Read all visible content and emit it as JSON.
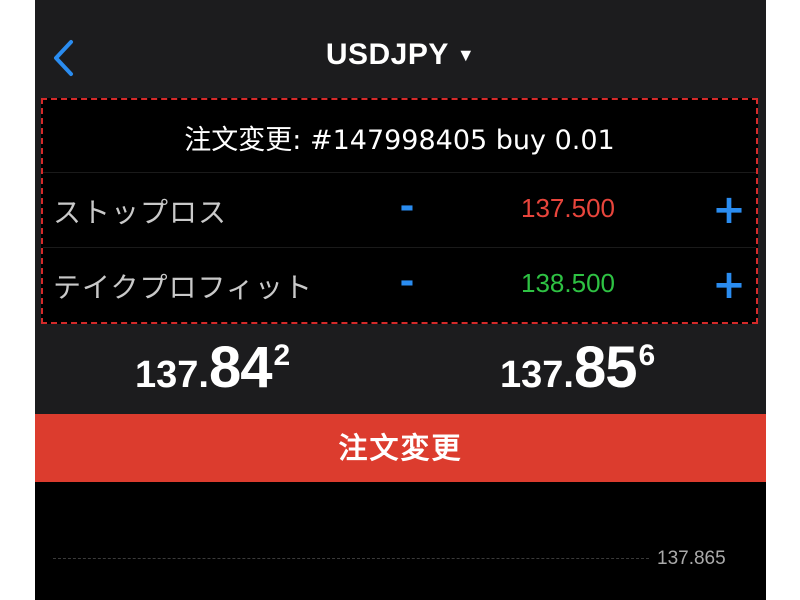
{
  "header": {
    "back_icon": "chevron-left-icon",
    "symbol": "USDJPY",
    "caret": "▼"
  },
  "order": {
    "title": "注文変更: #147998405 buy 0.01",
    "stop_loss": {
      "label": "ストップロス",
      "minus": "-",
      "plus": "+",
      "value": "137.500",
      "color": "#e8453c"
    },
    "take_profit": {
      "label": "テイクプロフィット",
      "minus": "-",
      "plus": "+",
      "value": "138.500",
      "color": "#2ec243"
    }
  },
  "quotes": {
    "bid": {
      "small": "137.",
      "big": "84",
      "sup": "2"
    },
    "ask": {
      "small": "137.",
      "big": "85",
      "sup": "6"
    }
  },
  "modify_button": {
    "label": "注文変更",
    "color": "#dc3c2e"
  },
  "chart": {
    "price_label": "137.865"
  },
  "colors": {
    "accent_blue": "#2a8cf0",
    "panel_border": "#d42a2a",
    "background": "#1c1c1e"
  }
}
